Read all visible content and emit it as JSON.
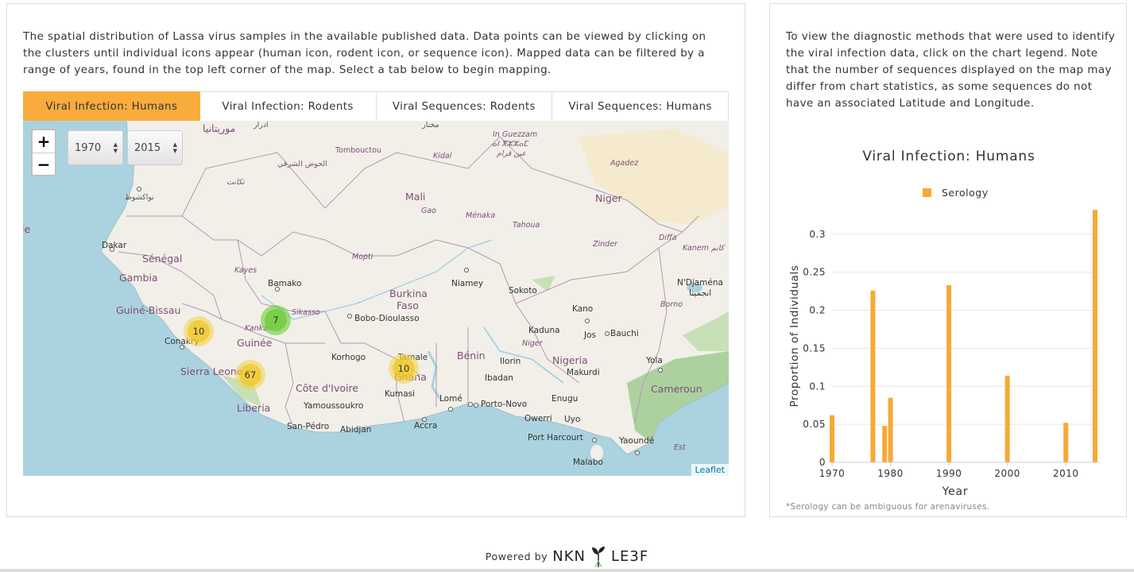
{
  "left_panel": {
    "description": "The spatial distribution of Lassa virus samples in the available published data. Data points can be viewed by clicking on the clusters until individual icons appear (human icon, rodent icon, or sequence icon). Mapped data can be filtered by a range of years, found in the top left corner of the map. Select a tab below to begin mapping.",
    "tabs": [
      {
        "label": "Viral Infection: Humans",
        "active": true
      },
      {
        "label": "Viral Infection: Rodents",
        "active": false
      },
      {
        "label": "Viral Sequences: Rodents",
        "active": false
      },
      {
        "label": "Viral Sequences: Humans",
        "active": false
      }
    ],
    "map": {
      "zoom_in": "+",
      "zoom_out": "−",
      "year_from": "1970",
      "year_to": "2015",
      "attribution": "Leaflet",
      "clusters": [
        {
          "count": "10",
          "color": "yellow"
        },
        {
          "count": "7",
          "color": "green"
        },
        {
          "count": "67",
          "color": "yellow"
        },
        {
          "count": "10",
          "color": "yellow"
        }
      ],
      "labels": {
        "mauritania": "موريتانيا",
        "adrar": "ادرار",
        "mokhtar": "مختار",
        "in_guezzam": "In Guezzam",
        "in_guezzam_tif": "ⴰⵏ ⴳⵣⵣⴰⵎ",
        "in_guezzam_ar": "عين قزام",
        "tombouctou": "Tombouctou",
        "hodh": "الحوض الشرقي",
        "kidal": "Kidal",
        "agadez": "Agadez",
        "tagant": "تكانت",
        "mali": "Mali",
        "gao": "Gao",
        "niger": "Niger",
        "nouakchott": "نواكشوط",
        "menaka": "Ménaka",
        "tahoua": "Tahoua",
        "le": "le",
        "dakar": "Dakar",
        "senegal": "Sénégal",
        "zinder": "Zinder",
        "diffa": "Diffa",
        "kanem": "Kanem كانم",
        "mopti": "Mopti",
        "kayes": "Kayes",
        "gambia": "Gambia",
        "bamako": "Bamako",
        "burkina": "Burkina",
        "faso": "Faso",
        "niamey": "Niamey",
        "sokoto": "Sokoto",
        "ndjamena": "N'Djaména",
        "ndjamena_ar": "انجمينا",
        "guinea_bissau": "Guiné-Bissau",
        "sikasso": "Sikasso",
        "kano": "Kano",
        "borno": "Borno",
        "bobo": "Bobo-Dioulasso",
        "kankan": "Kankan",
        "conakry": "Conakry",
        "guinee": "Guinée",
        "kaduna": "Kaduna",
        "jos": "Jos",
        "bauchi": "Bauchi",
        "tamale": "Tamale",
        "benin": "Bénin",
        "korhogo": "Korhogo",
        "niger_state": "Niger",
        "sierra_leone": "Sierra Leone",
        "ilorin": "Ilorin",
        "nigeria": "Nigeria",
        "yola": "Yola",
        "ghana": "Ghana",
        "makurdi": "Makurdi",
        "ibadan": "Ibadan",
        "cote": "Côte d'Ivoire",
        "cameroun": "Cameroun",
        "kumasi": "Kumasi",
        "lome": "Lomé",
        "porto_novo": "Porto-Novo",
        "enugu": "Enugu",
        "liberia": "Liberia",
        "yamoussoukro": "Yamoussoukro",
        "owerri": "Owerri",
        "uyo": "Uyo",
        "san_pedro": "San-Pédro",
        "abidjan": "Abidjan",
        "accra": "Accra",
        "port_harcourt": "Port Harcourt",
        "yaounde": "Yaoundé",
        "est": "Est",
        "malabo": "Malabo"
      }
    }
  },
  "right_panel": {
    "description": "To view the diagnostic methods that were used to identify the viral infection data, click on the chart legend. Note that the number of sequences displayed on the map may differ from chart statistics, as some sequences do not have an associated Latitude and Longitude.",
    "note": "*Serology can be ambiguous for arenaviruses."
  },
  "chart_data": {
    "type": "bar",
    "title": "Viral Infection: Humans",
    "xlabel": "Year",
    "ylabel": "Proportion of Individuals",
    "series": [
      {
        "name": "Serology",
        "color": "#f7a935",
        "x": [
          1970,
          1977,
          1979,
          1980,
          1990,
          2000,
          2010,
          2015
        ],
        "values": [
          0.062,
          0.226,
          0.048,
          0.085,
          0.233,
          0.114,
          0.052,
          0.332
        ]
      }
    ],
    "xlim": [
      1970,
      2015
    ],
    "ylim": [
      0,
      0.35
    ],
    "xticks": [
      1970,
      1980,
      1990,
      2000,
      2010
    ],
    "xtick_labels": [
      "1970",
      "1980",
      "1990",
      "2000",
      "2010"
    ],
    "yticks": [
      0,
      0.05,
      0.1,
      0.15,
      0.2,
      0.25,
      0.3
    ],
    "ytick_labels": [
      "0",
      "0.05",
      "0.1",
      "0.15",
      "0.2",
      "0.25",
      "0.3"
    ],
    "legend_position": "top",
    "grid": true
  },
  "footer": {
    "powered_by": "Powered by",
    "brand_left": "NKN",
    "brand_right": "LE3F"
  }
}
